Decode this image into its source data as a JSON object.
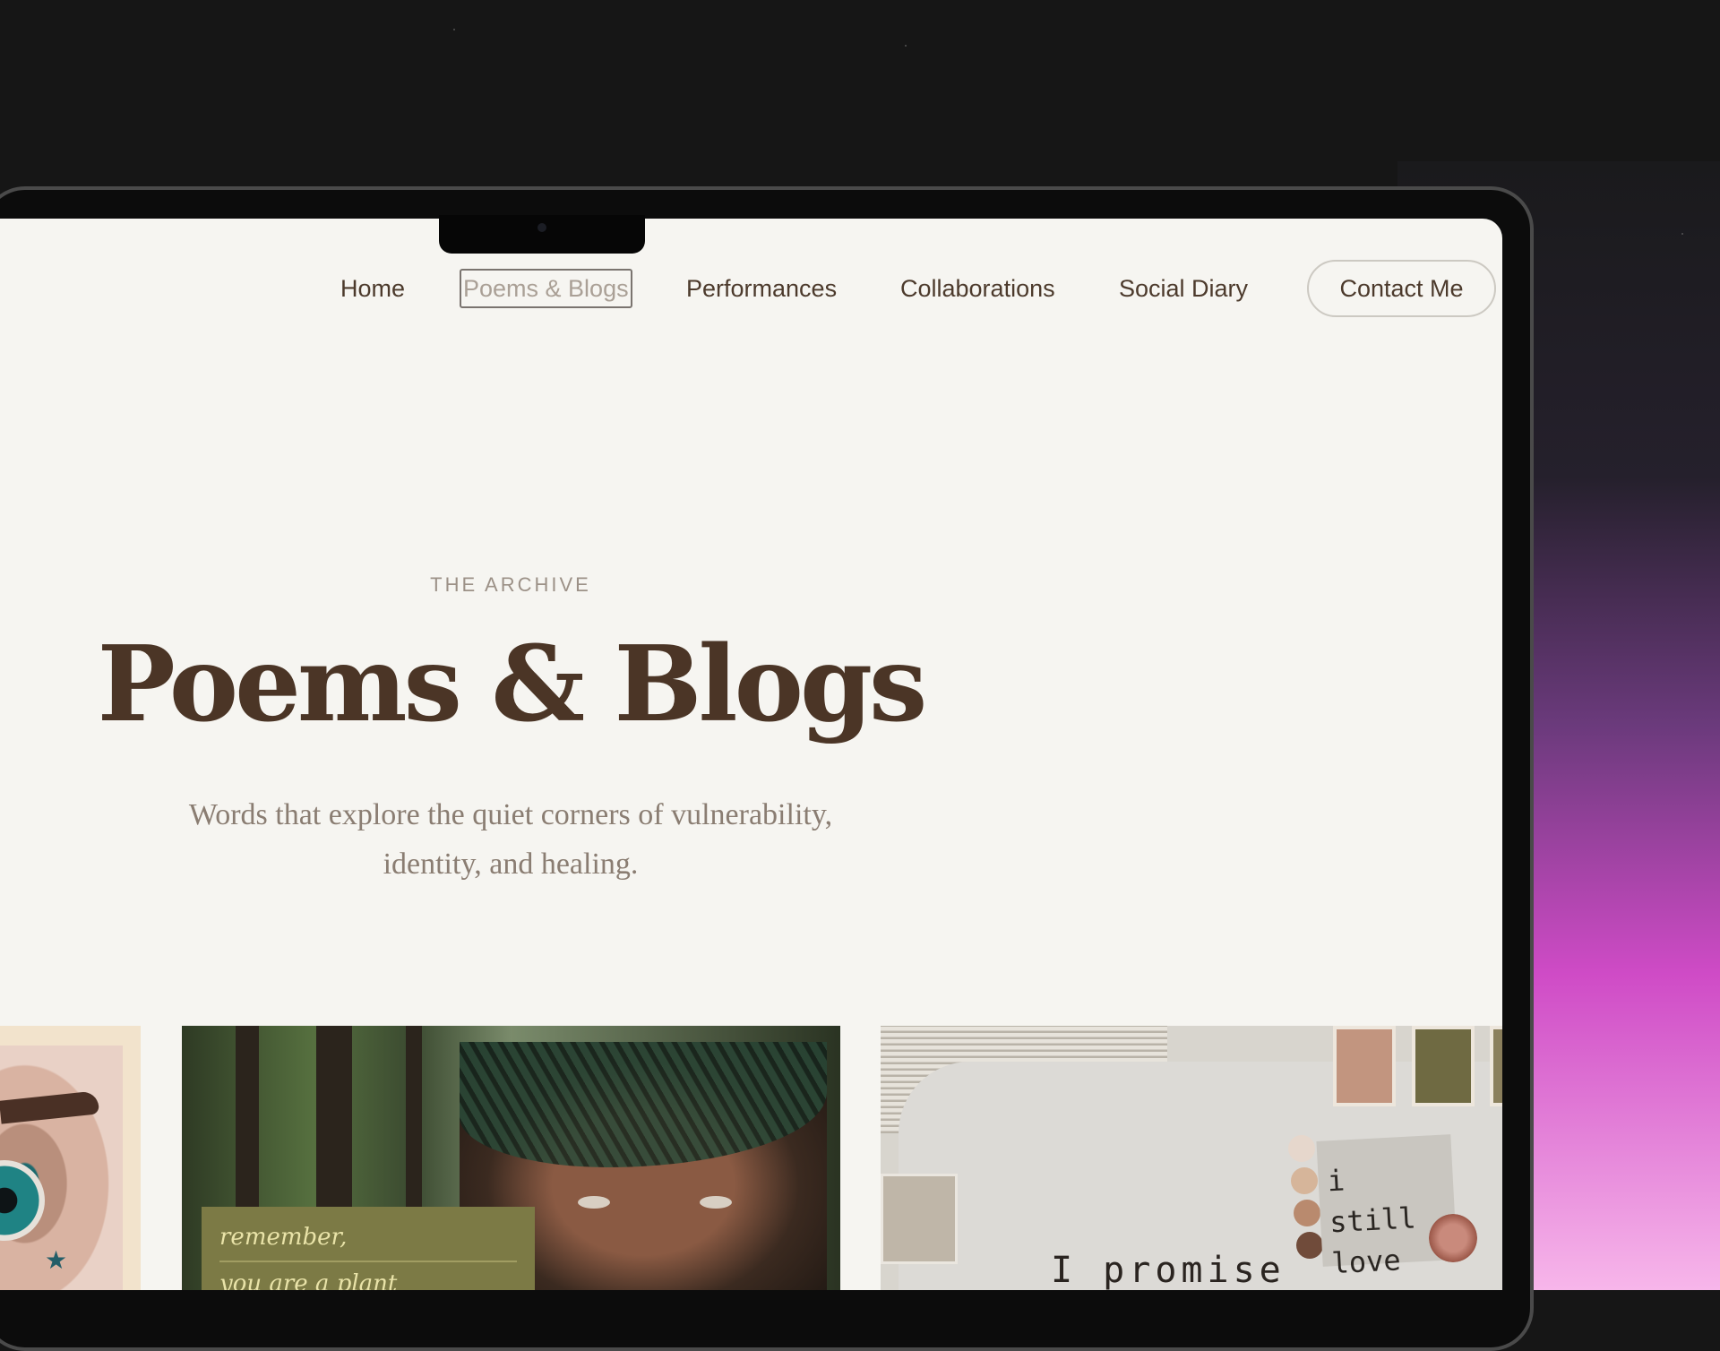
{
  "nav": {
    "home": "Home",
    "poems_blogs": "Poems & Blogs",
    "performances": "Performances",
    "collaborations": "Collaborations",
    "social_diary": "Social Diary",
    "contact": "Contact Me"
  },
  "hero": {
    "eyebrow": "THE ARCHIVE",
    "title": "Poems & Blogs",
    "subtitle_line1": "Words that explore the quiet corners of vulnerability,",
    "subtitle_line2": "identity, and healing."
  },
  "cards": [
    {
      "image": "eye-closeup-photo"
    },
    {
      "image": "fern-portrait-photo",
      "note_line1": "remember,",
      "note_line2": "you are a plant"
    },
    {
      "image": "collage-photo",
      "tag_line1": "i still",
      "tag_line2": "love you",
      "caption": "I promise"
    }
  ],
  "colors": {
    "page_bg": "#f6f5f1",
    "heading": "#4b3526",
    "body_text": "#8a7d72",
    "nav_text": "#4c3a2c",
    "accent_gradient_end": "#cf4bc6"
  }
}
